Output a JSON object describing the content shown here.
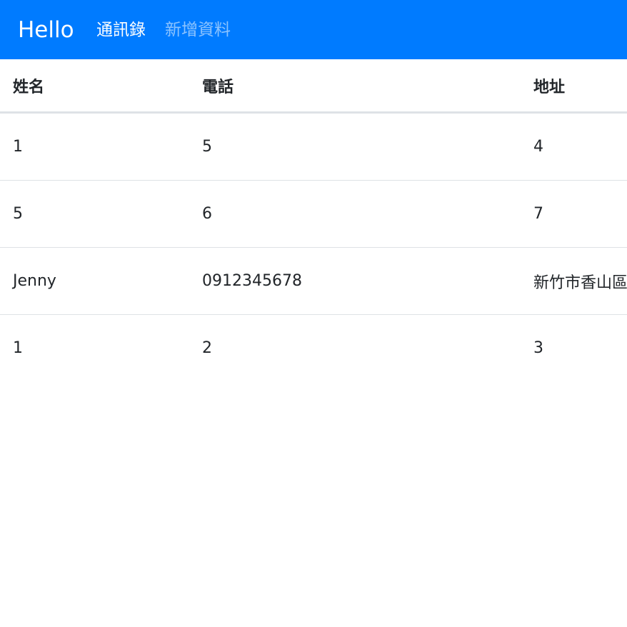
{
  "navbar": {
    "brand": "Hello",
    "links": [
      {
        "label": "通訊錄",
        "active": true
      },
      {
        "label": "新增資料",
        "active": false
      }
    ],
    "color": "#007bff"
  },
  "table": {
    "headers": [
      "姓名",
      "電話",
      "地址"
    ],
    "rows": [
      [
        "1",
        "5",
        "4"
      ],
      [
        "5",
        "6",
        "7"
      ],
      [
        "Jenny",
        "0912345678",
        "新竹市香山區"
      ],
      [
        "1",
        "2",
        "3"
      ]
    ]
  }
}
